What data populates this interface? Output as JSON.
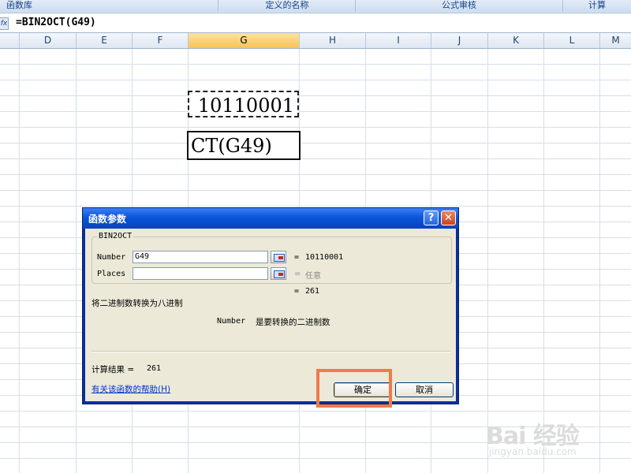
{
  "ribbon": {
    "groups": [
      "函数库",
      "定义的名称",
      "公式审核",
      "计算"
    ]
  },
  "formula_bar": {
    "formula": "=BIN2OCT(G49)"
  },
  "columns": [
    "D",
    "E",
    "F",
    "G",
    "H",
    "I",
    "J",
    "K",
    "L",
    "M"
  ],
  "selected_column": "G",
  "cells": {
    "source_value": "10110001",
    "editing_text": "CT(G49)"
  },
  "dialog": {
    "title": "函数参数",
    "help_button": "?",
    "close_button": "✕",
    "function_name": "BIN2OCT",
    "args": [
      {
        "label": "Number",
        "value": "G49",
        "result": "10110001"
      },
      {
        "label": "Places",
        "value": "",
        "result": "任意"
      }
    ],
    "equals": "=",
    "preview_result": "261",
    "description": "将二进制数转换为八进制",
    "arg_help_name": "Number",
    "arg_help_text": "是要转换的二进制数",
    "calc_result_label": "计算结果 =",
    "calc_result_value": "261",
    "help_link": "有关该函数的帮助(H)",
    "ok_label": "确定",
    "cancel_label": "取消"
  },
  "watermark": {
    "logo": "Bai 经验",
    "url": "jingyan.baidu.com"
  },
  "colors": {
    "title_bar": "#0a55d9",
    "dialog_bg": "#ece9d8",
    "highlight": "#f07a4a",
    "selected_header": "#f8c356"
  }
}
